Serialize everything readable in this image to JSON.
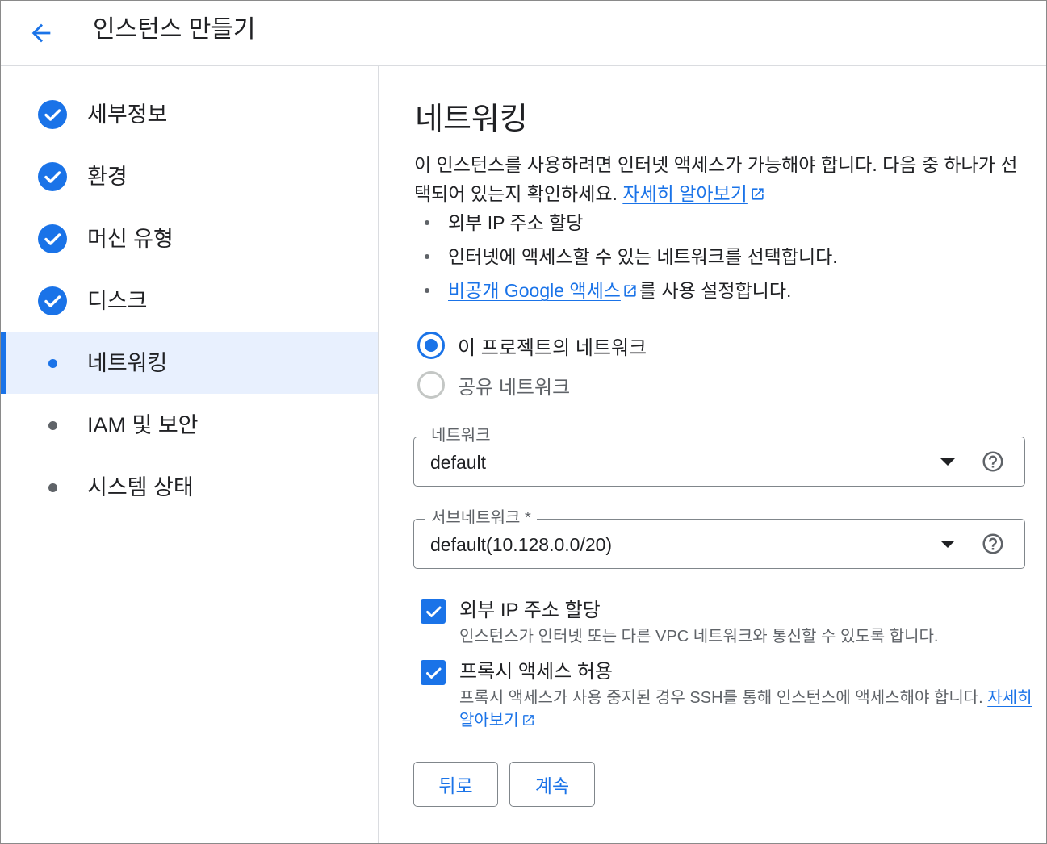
{
  "header": {
    "title": "인스턴스 만들기"
  },
  "sidebar": {
    "steps": [
      {
        "label": "세부정보",
        "status": "complete"
      },
      {
        "label": "환경",
        "status": "complete"
      },
      {
        "label": "머신 유형",
        "status": "complete"
      },
      {
        "label": "디스크",
        "status": "complete"
      },
      {
        "label": "네트워킹",
        "status": "active"
      },
      {
        "label": "IAM 및 보안",
        "status": "pending"
      },
      {
        "label": "시스템 상태",
        "status": "pending"
      }
    ]
  },
  "main": {
    "title": "네트워킹",
    "description": "이 인스턴스를 사용하려면 인터넷 액세스가 가능해야 합니다. 다음 중 하나가 선택되어 있는지 확인하세요.",
    "learn_more": "자세히 알아보기",
    "bullets": {
      "b1": "외부 IP 주소 할당",
      "b2": "인터넷에 액세스할 수 있는 네트워크를 선택합니다.",
      "b3_link": "비공개 Google 액세스",
      "b3_rest": "를 사용 설정합니다."
    },
    "network_source": {
      "options": [
        {
          "label": "이 프로젝트의 네트워크",
          "selected": true
        },
        {
          "label": "공유 네트워크",
          "selected": false
        }
      ]
    },
    "network_field": {
      "label": "네트워크",
      "value": "default"
    },
    "subnet_field": {
      "label": "서브네트워크 *",
      "value": "default(10.128.0.0/20)"
    },
    "external_ip": {
      "checked": true,
      "title": "외부 IP 주소 할당",
      "description": "인스턴스가 인터넷 또는 다른 VPC 네트워크와 통신할 수 있도록 합니다."
    },
    "proxy_access": {
      "checked": true,
      "title": "프록시 액세스 허용",
      "description": "프록시 액세스가 사용 중지된 경우 SSH를 통해 인스턴스에 액세스해야 합니다.",
      "learn_more": "자세히 알아보기"
    },
    "buttons": {
      "back": "뒤로",
      "continue": "계속"
    }
  },
  "colors": {
    "accent": "#1a73e8",
    "active_bg": "#e8f0fe",
    "text": "#202124",
    "muted": "#5f6368",
    "border": "#80868b"
  }
}
